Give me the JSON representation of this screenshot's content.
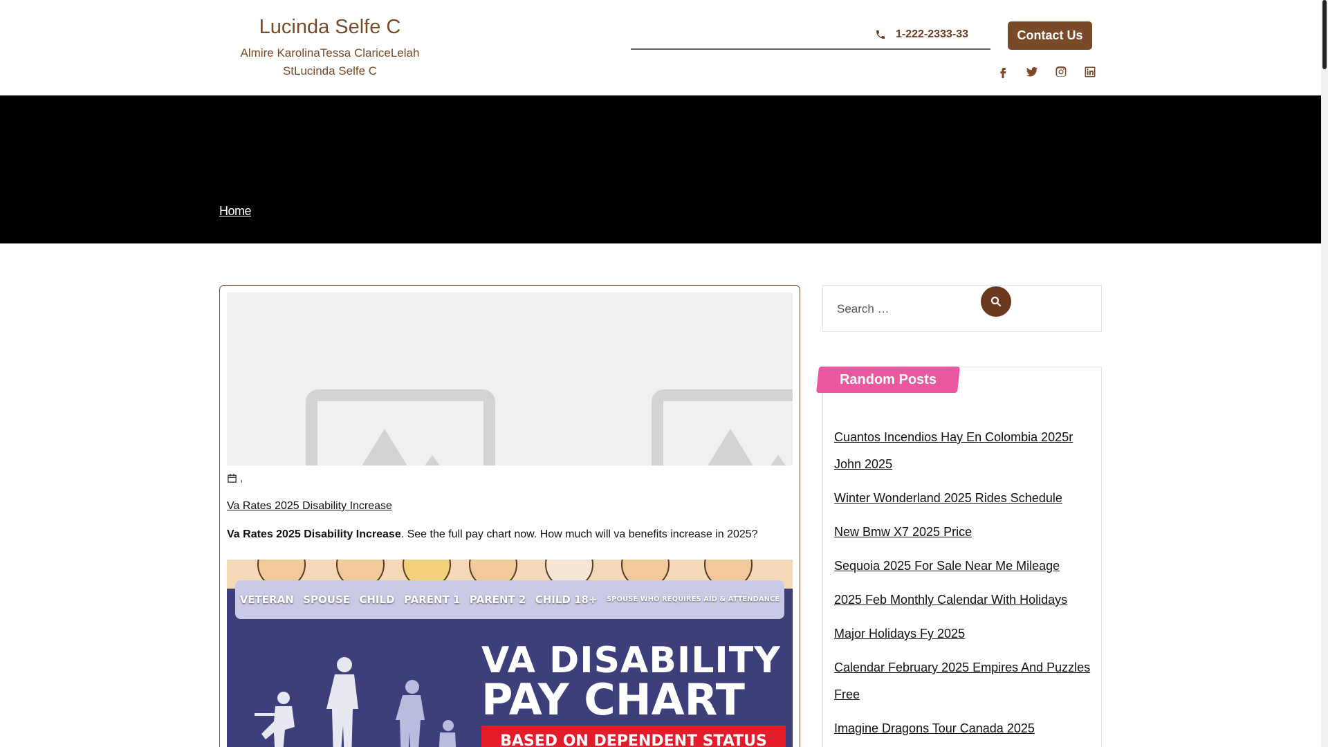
{
  "header": {
    "site_title": "Lucinda Selfe C",
    "site_description": "Almire KarolinaTessa ClariceLelah StLucinda Selfe C",
    "phone": "1-222-2333-33",
    "contact_button": "Contact Us",
    "social_icons": [
      "facebook-icon",
      "twitter-icon",
      "instagram-icon",
      "linkedin-icon"
    ]
  },
  "banner": {
    "breadcrumb_home": "Home"
  },
  "post": {
    "meta_separator": ",",
    "title": "Va Rates 2025 Disability Increase",
    "excerpt_bold": "Va Rates 2025 Disability Increase",
    "excerpt_rest": ". See the full pay chart now. How much will va benefits increase in 2025?",
    "image": {
      "face_labels": [
        "VETERAN",
        "SPOUSE",
        "CHILD",
        "PARENT 1",
        "PARENT 2",
        "CHILD 18+"
      ],
      "face_label_small": "SPOUSE WHO REQUIRES AID & ATTENDANCE",
      "line1": "VA DISABILITY",
      "line2": "PAY CHART",
      "ribbon": "BASED ON DEPENDENT STATUS"
    }
  },
  "sidebar": {
    "search_placeholder": "Search …",
    "random_posts_title": "Random Posts",
    "random_posts": [
      "Cuantos Incendios Hay En Colombia 2025r John 2025",
      "Winter Wonderland 2025 Rides Schedule",
      "New Bmw X7 2025 Price",
      "Sequoia 2025 For Sale Near Me Mileage",
      "2025 Feb Monthly Calendar With Holidays",
      "Major Holidays Fy 2025",
      "Calendar February 2025 Empires And Puzzles Free",
      "Imagine Dragons Tour Canada 2025"
    ]
  },
  "colors": {
    "brand_brown": "#7a4a28",
    "banner_black": "#000000",
    "random_posts_pink": "#e9579e"
  }
}
